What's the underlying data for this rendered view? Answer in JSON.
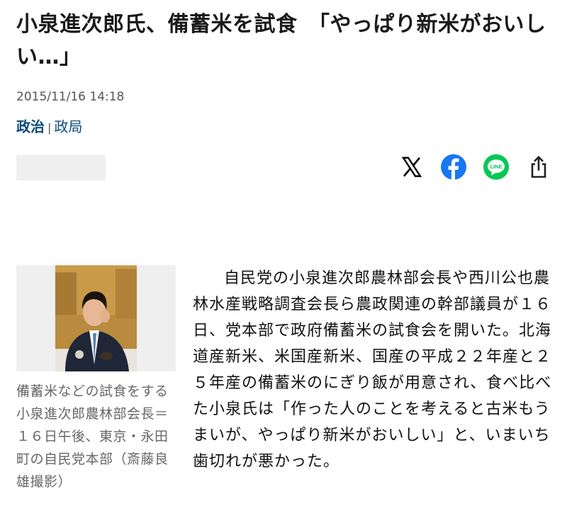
{
  "article": {
    "title": "小泉進次郎氏、備蓄米を試食　「やっぱり新米がおいしい…」",
    "date": "2015/11/16 14:18",
    "category_main": "政治",
    "category_separator": "|",
    "category_sub": "政局"
  },
  "share": {
    "icons": [
      "x-icon",
      "facebook-icon",
      "line-icon",
      "share-icon"
    ],
    "line_label": "LINE",
    "colors": {
      "x": "#000000",
      "facebook": "#1877f2",
      "line": "#06c755",
      "share": "#222222"
    }
  },
  "figure": {
    "caption": "備蓄米などの試食をする小泉進次郎農林部会長＝１６日午後、東京・永田町の自民党本部（斎藤良雄撮影）"
  },
  "body": {
    "paragraph": "自民党の小泉進次郎農林部会長や西川公也農林水産戦略調査会長ら農政関連の幹部議員が１６日、党本部で政府備蓄米の試食会を開いた。北海道産新米、米国産新米、国産の平成２２年産と２５年産の備蓄米のにぎり飯が用意され、食べ比べた小泉氏は「作った人のことを考えると古米もうまいが、やっぱり新米がおいしい」と、いまいち歯切れが悪かった。"
  }
}
